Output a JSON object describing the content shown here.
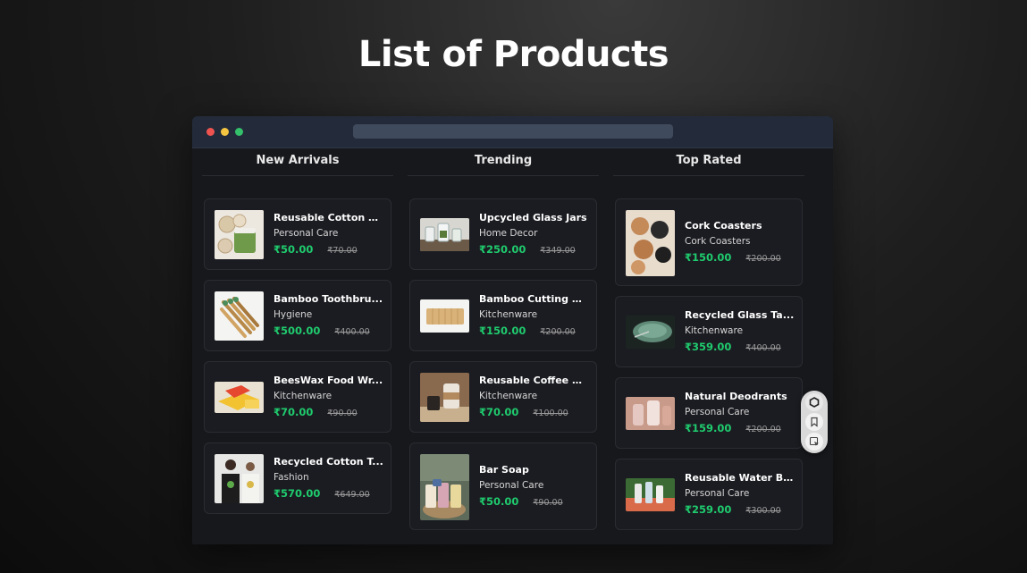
{
  "page": {
    "title": "List of Products"
  },
  "columns": [
    {
      "heading": "New Arrivals",
      "products": [
        {
          "name": "Reusable Cotton P...",
          "category": "Personal Care",
          "price": "₹50.00",
          "old_price": "₹70.00"
        },
        {
          "name": "Bamboo Toothbru...",
          "category": "Hygiene",
          "price": "₹500.00",
          "old_price": "₹400.00"
        },
        {
          "name": "BeesWax Food Wr...",
          "category": "Kitchenware",
          "price": "₹70.00",
          "old_price": "₹90.00"
        },
        {
          "name": "Recycled Cotton T...",
          "category": "Fashion",
          "price": "₹570.00",
          "old_price": "₹649.00"
        }
      ]
    },
    {
      "heading": "Trending",
      "products": [
        {
          "name": "Upcycled Glass Jars",
          "category": "Home Decor",
          "price": "₹250.00",
          "old_price": "₹349.00"
        },
        {
          "name": "Bamboo Cutting B...",
          "category": "Kitchenware",
          "price": "₹150.00",
          "old_price": "₹200.00"
        },
        {
          "name": "Reusable Coffee M...",
          "category": "Kitchenware",
          "price": "₹70.00",
          "old_price": "₹100.00"
        },
        {
          "name": "Bar Soap",
          "category": "Personal Care",
          "price": "₹50.00",
          "old_price": "₹90.00"
        }
      ]
    },
    {
      "heading": "Top Rated",
      "products": [
        {
          "name": "Cork Coasters",
          "category": "Cork Coasters",
          "price": "₹150.00",
          "old_price": "₹200.00"
        },
        {
          "name": "Recycled Glass Ta...",
          "category": "Kitchenware",
          "price": "₹359.00",
          "old_price": "₹400.00"
        },
        {
          "name": "Natural Deodrants",
          "category": "Personal Care",
          "price": "₹159.00",
          "old_price": "₹200.00"
        },
        {
          "name": "Reusable Water Bo...",
          "category": "Personal Care",
          "price": "₹259.00",
          "old_price": "₹300.00"
        }
      ]
    }
  ],
  "colors": {
    "price": "#1fcb6e",
    "background": "#17181c",
    "titlebar": "#232b3a"
  },
  "floating_toolbar": {
    "icons": [
      "hexagon-icon",
      "bookmark-icon",
      "select-icon"
    ]
  }
}
